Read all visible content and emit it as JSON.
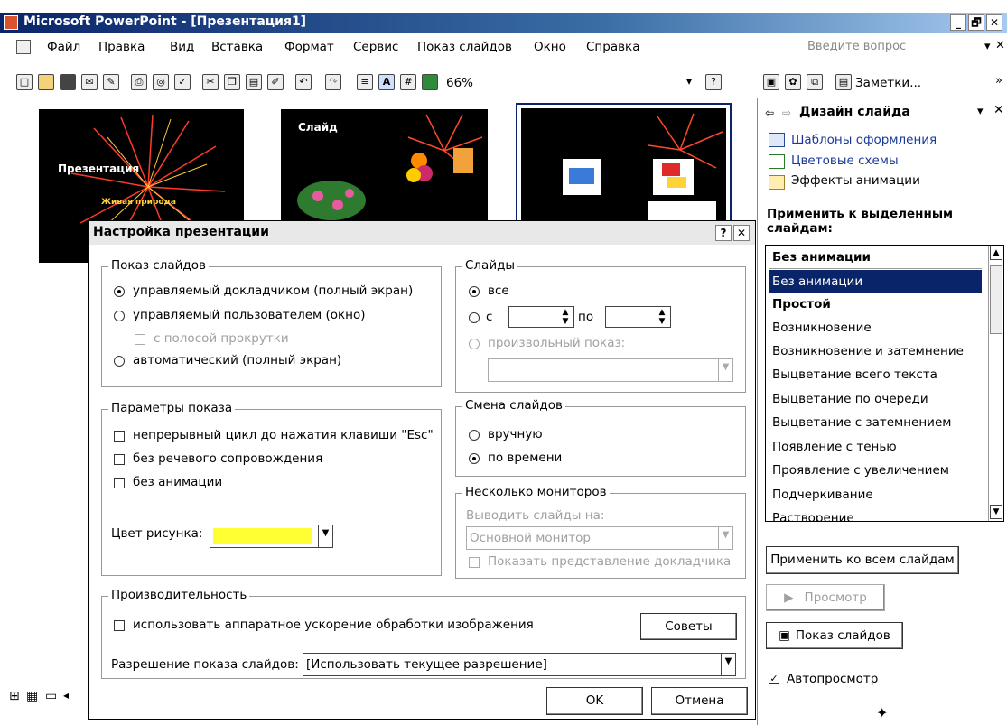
{
  "window": {
    "title": "Microsoft PowerPoint - [Презентация1]",
    "min_glyph": "_",
    "restore_glyph": "🗗",
    "close_glyph": "✕"
  },
  "menu": {
    "items": [
      "Файл",
      "Правка",
      "Вид",
      "Вставка",
      "Формат",
      "Сервис",
      "Показ слайдов",
      "Окно",
      "Справка"
    ],
    "ask_placeholder": "Введите вопрос"
  },
  "toolbar": {
    "zoom": "66%",
    "notes_label": "Заметки..."
  },
  "slides": {
    "thumb1_title": "Презентация",
    "thumb1_subtitle": "Живая природа",
    "thumb2_title": "Слайд"
  },
  "dialog": {
    "title": "Настройка презентации",
    "help_glyph": "?",
    "close_glyph": "✕",
    "show": {
      "group_label": "Показ слайдов",
      "presenter": "управляемый докладчиком (полный экран)",
      "individual": "управляемый пользователем (окно)",
      "scrollbar": "с полосой прокрутки",
      "kiosk": "автоматический (полный экран)"
    },
    "slides": {
      "group_label": "Слайды",
      "all": "все",
      "from": "с",
      "to": "по",
      "custom": "произвольный показ:"
    },
    "options": {
      "group_label": "Параметры показа",
      "loop": "непрерывный цикл до нажатия клавиши \"Esc\"",
      "no_narration": "без речевого сопровождения",
      "no_animation": "без анимации",
      "pen_color_label": "Цвет рисунка:",
      "pen_color": "#ffff33"
    },
    "advance": {
      "group_label": "Смена слайдов",
      "manual": "вручную",
      "timings": "по времени"
    },
    "monitors": {
      "group_label": "Несколько мониторов",
      "display_label": "Выводить слайды на:",
      "display_value": "Основной монитор",
      "presenter_view": "Показать представление докладчика"
    },
    "performance": {
      "group_label": "Производительность",
      "hw_accel": "использовать аппаратное ускорение обработки изображения",
      "tips_button": "Советы",
      "resolution_label": "Разрешение показа слайдов:",
      "resolution_value": "[Использовать текущее разрешение]"
    },
    "ok": "OK",
    "cancel": "Отмена"
  },
  "pane": {
    "title": "Дизайн слайда",
    "links": [
      "Шаблоны оформления",
      "Цветовые схемы",
      "Эффекты анимации"
    ],
    "apply_label": "Применить к выделенным слайдам:",
    "dropdown_value": "Без анимации",
    "list": [
      "Без анимации",
      "Простой",
      "Возникновение",
      "Возникновение и затемнение",
      "Выцветание всего текста",
      "Выцветание по очереди",
      "Выцветание с затемнением",
      "Появление с тенью",
      "Проявление с увеличением",
      "Подчеркивание",
      "Растворение"
    ],
    "apply_all": "Применить ко всем слайдам",
    "preview": "Просмотр",
    "slideshow": "Показ слайдов",
    "autopreview": "Автопросмотр"
  }
}
